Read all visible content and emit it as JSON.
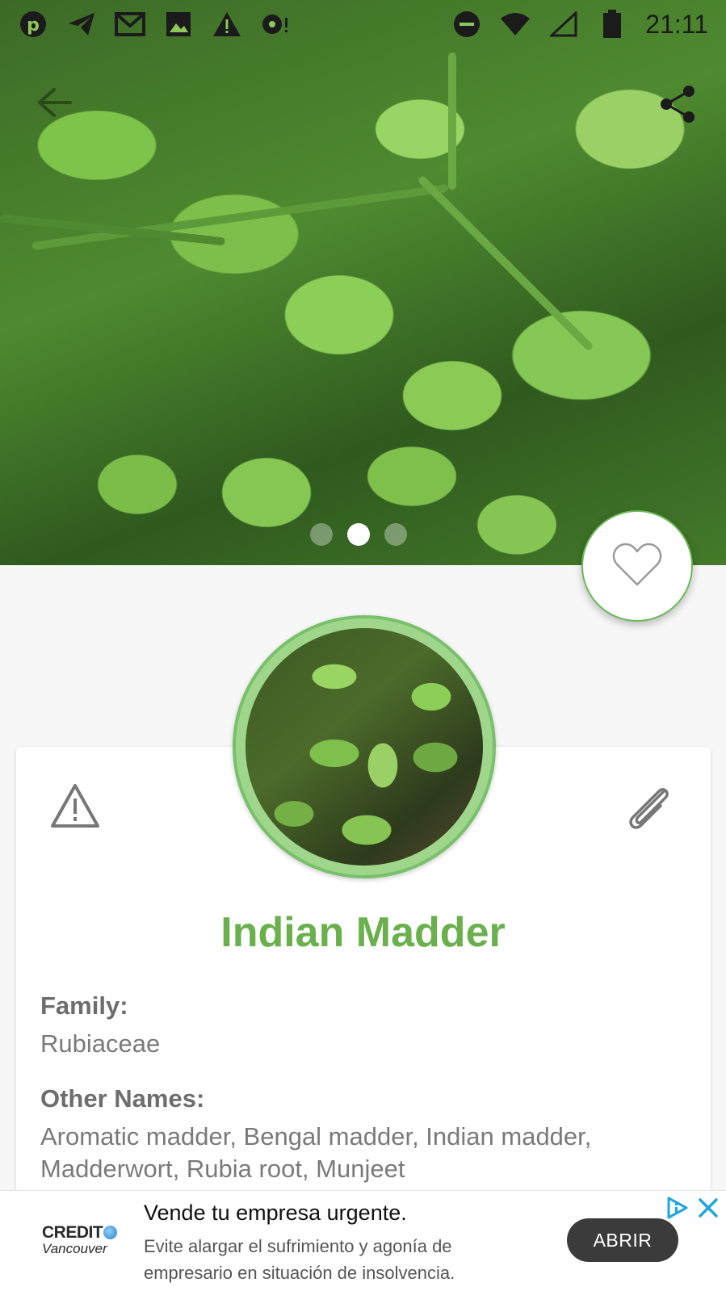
{
  "status_bar": {
    "time": "21:11",
    "left_icons": [
      "pinterest-icon",
      "telegram-icon",
      "gmail-icon",
      "gallery-icon",
      "warning-icon",
      "chat-icon"
    ],
    "right_icons": [
      "do-not-disturb-icon",
      "wifi-icon",
      "signal-icon",
      "battery-icon"
    ]
  },
  "header": {
    "back_icon": "back-arrow-icon",
    "share_icon": "share-icon"
  },
  "gallery": {
    "page_count": 3,
    "active_page": 2
  },
  "favorite": {
    "icon": "heart-outline-icon"
  },
  "plant": {
    "name": "Indian Madder",
    "family_label": "Family:",
    "family_value": "Rubiaceae",
    "other_names_label": "Other Names:",
    "other_names_value": "Aromatic madder, Bengal madder, Indian madder, Madderwort, Rubia root, Munjeet"
  },
  "card_icons": {
    "report": "warning-triangle-icon",
    "attach": "paperclip-icon"
  },
  "ad": {
    "brand_line1": "CREDIT",
    "brand_line2": "Vancouver",
    "title": "Vende tu empresa urgente.",
    "description": "Evite alargar el sufrimiento y agonía de empresario en situación de insolvencia.",
    "button_label": "ABRIR"
  },
  "colors": {
    "accent_green": "#6ab04c",
    "text_gray": "#7a7a7a",
    "ad_button": "#3b3b3b",
    "ad_choices_blue": "#1fa5e0"
  }
}
